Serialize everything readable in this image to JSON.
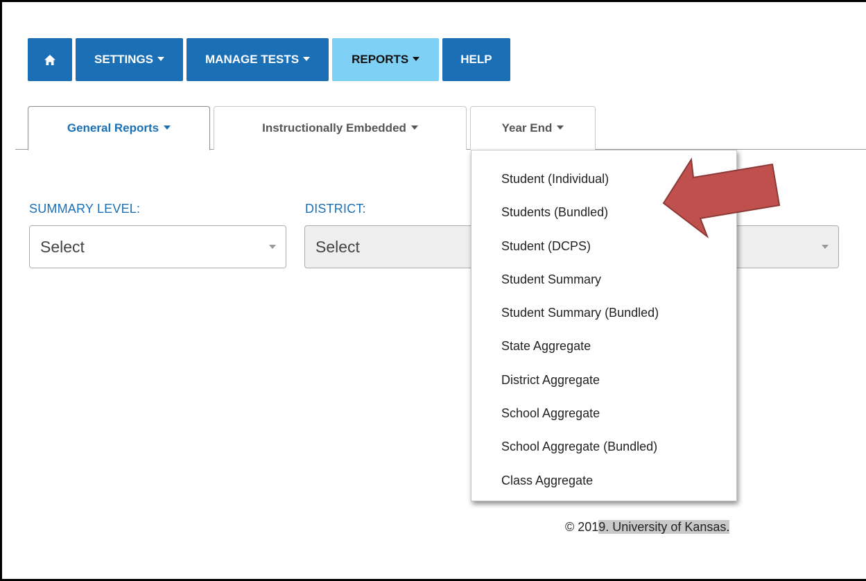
{
  "nav": {
    "home_icon": "home-icon",
    "items": [
      {
        "label": "SETTINGS",
        "has_caret": true
      },
      {
        "label": "MANAGE TESTS",
        "has_caret": true
      },
      {
        "label": "REPORTS",
        "has_caret": true,
        "active": true
      },
      {
        "label": "HELP",
        "has_caret": false
      }
    ]
  },
  "tabs": [
    {
      "label": "General Reports",
      "active": true
    },
    {
      "label": "Instructionally Embedded",
      "active": false
    },
    {
      "label": "Year End",
      "active": false
    }
  ],
  "filters": {
    "summary_level": {
      "label": "SUMMARY LEVEL:",
      "value": "Select"
    },
    "district": {
      "label": "DISTRICT:",
      "value": "Select",
      "disabled": true
    }
  },
  "year_end_menu": {
    "items": [
      "Student (Individual)",
      "Students (Bundled)",
      "Student (DCPS)",
      "Student Summary",
      "Student Summary (Bundled)",
      "State Aggregate",
      "District Aggregate",
      "School Aggregate",
      "School Aggregate (Bundled)",
      "Class Aggregate"
    ]
  },
  "footer": {
    "prefix": "© 201",
    "highlighted": "9. University of Kansas."
  },
  "colors": {
    "nav_blue": "#1a6fb5",
    "nav_active": "#7fd0f5",
    "arrow_fill": "#c0504d",
    "arrow_stroke": "#8c3836"
  }
}
